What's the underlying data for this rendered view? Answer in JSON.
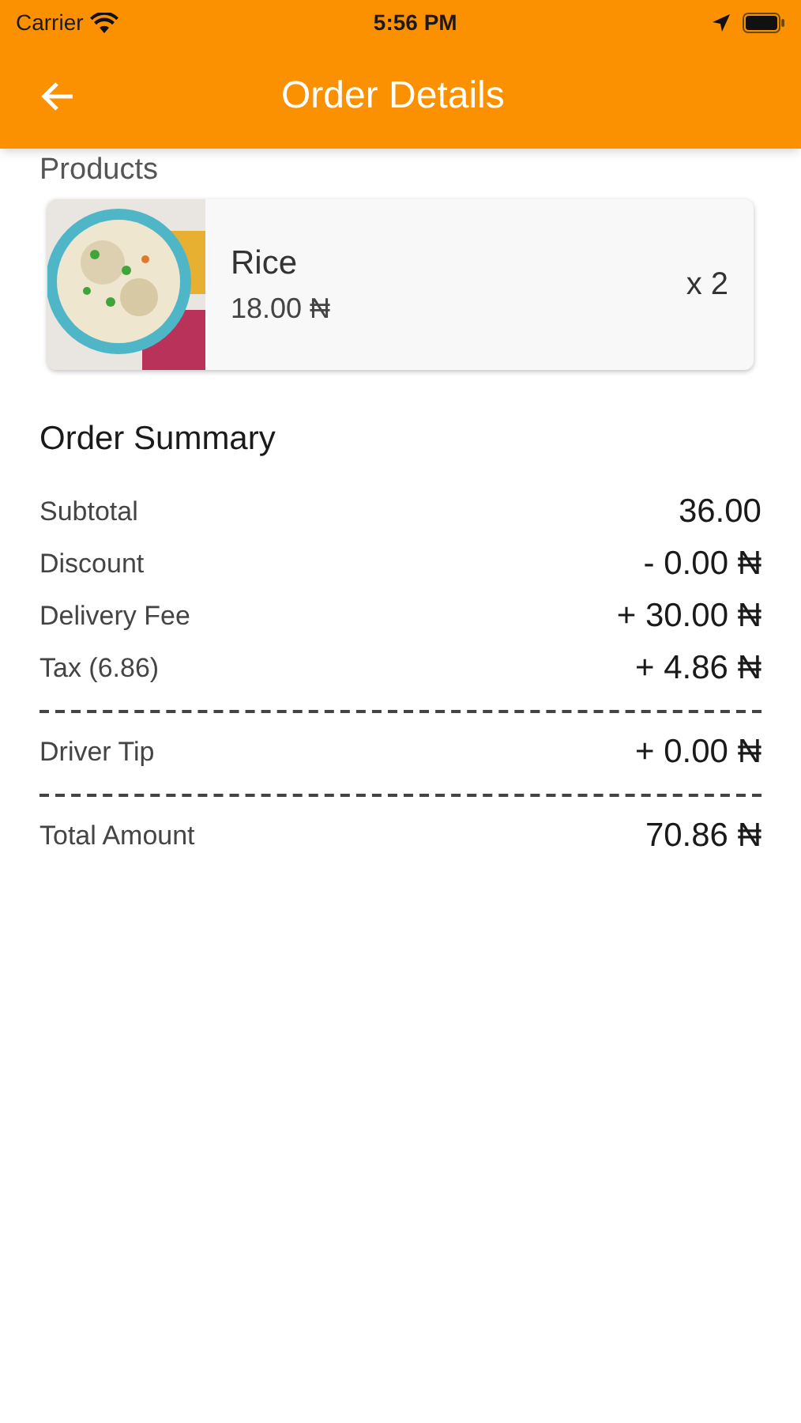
{
  "status_bar": {
    "carrier": "Carrier",
    "time": "5:56 PM"
  },
  "header": {
    "title": "Order Details"
  },
  "products": {
    "heading": "Products",
    "items": [
      {
        "name": "Rice",
        "price": "18.00 ₦",
        "quantity": "x 2"
      }
    ]
  },
  "summary": {
    "heading": "Order Summary",
    "lines": [
      {
        "kind": "row",
        "label": "Subtotal",
        "value": "36.00"
      },
      {
        "kind": "row",
        "label": "Discount",
        "value": "- 0.00 ₦"
      },
      {
        "kind": "row",
        "label": "Delivery Fee",
        "value": "+ 30.00 ₦"
      },
      {
        "kind": "row",
        "label": "Tax (6.86)",
        "value": "+ 4.86 ₦"
      },
      {
        "kind": "divider"
      },
      {
        "kind": "row",
        "label": "Driver Tip",
        "value": "+ 0.00 ₦"
      },
      {
        "kind": "divider"
      },
      {
        "kind": "row",
        "label": "Total Amount",
        "value": "70.86 ₦"
      }
    ]
  }
}
